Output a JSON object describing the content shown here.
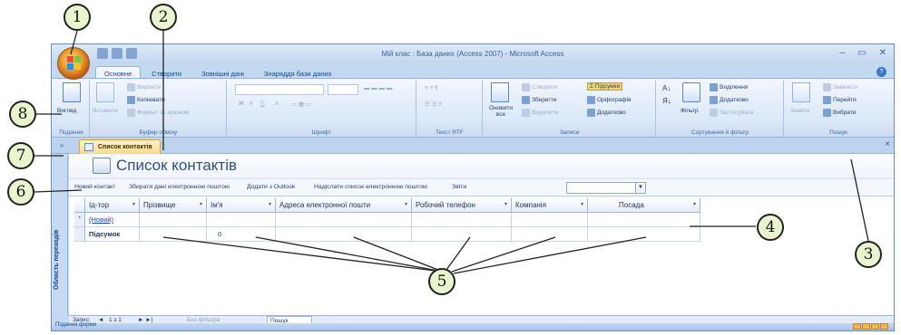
{
  "window": {
    "title": "Мій клас : База даних (Access 2007) - Microsoft Access"
  },
  "ribbon": {
    "tabs": [
      "Основне",
      "Створити",
      "Зовнішні дані",
      "Знаряддя бази даних"
    ],
    "active_tab": "Основне",
    "groups": {
      "views": {
        "label": "Подання",
        "view_button": "Вигляд"
      },
      "clipboard": {
        "label": "Буфер обміну",
        "paste": "Вставити",
        "cut": "Вирізати",
        "copy": "Копіювати",
        "format_painter": "Формат за зразком"
      },
      "font": {
        "label": "Шрифт",
        "bold": "Ж",
        "italic": "К",
        "underline": "П",
        "font_color": "А"
      },
      "rich_text": {
        "label": "Текст RTF"
      },
      "records": {
        "label": "Записи",
        "refresh": "Оновити все",
        "new": "Створити",
        "save": "Зберегти",
        "delete": "Видалити",
        "totals": "Σ Підсумки",
        "spelling": "Орфографія",
        "more": "Додатково"
      },
      "sort_filter": {
        "label": "Сортування й фільтр",
        "filter": "Фільтр",
        "selection": "Виділення",
        "advanced": "Додатково",
        "toggle": "Застосувати"
      },
      "find": {
        "label": "Пошук",
        "find": "Знайти",
        "replace": "Замінити",
        "goto": "Перейти",
        "select": "Вибрати"
      }
    }
  },
  "doc_tab": {
    "label": "Список контактів"
  },
  "nav_pane": {
    "label": "Область переходів",
    "toggle": "»"
  },
  "form": {
    "title": "Список контактів",
    "toolbar": [
      "Новий контакт",
      "Збирати дані електронною поштою",
      "Додати з Outlook",
      "Надіслати список електронною поштою",
      "Звіти"
    ],
    "reports_value": ""
  },
  "grid": {
    "columns": [
      "Ід-тор",
      "Прізвище",
      "Ім'я",
      "Адреса електронної пошти",
      "Робочий телефон",
      "Компанія",
      "Посада"
    ],
    "new_row_marker": "*",
    "new_row_label": "(Новий)",
    "total_row_label": "Підсумок",
    "total_value": "0"
  },
  "record_nav": {
    "prefix": "Запис:",
    "position": "1 з 1",
    "filter": "Без фільтра",
    "search": "Пошук"
  },
  "status": {
    "text": "Подання форми"
  },
  "callouts": [
    "1",
    "2",
    "3",
    "4",
    "5",
    "6",
    "7",
    "8"
  ],
  "colors": {
    "callout_fill": "#e8f5cf",
    "doc_tab": "#ffd985",
    "ribbon": "#dce8f8"
  }
}
